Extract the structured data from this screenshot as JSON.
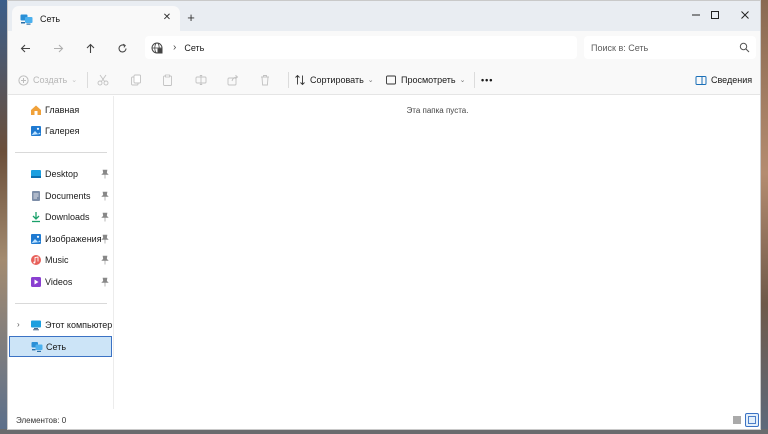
{
  "tab": {
    "title": "Сеть",
    "close": "✕",
    "new_tab": "+"
  },
  "window_controls": {
    "minimize": "—",
    "maximize": "☐",
    "close": "✕"
  },
  "address": {
    "path": "Сеть",
    "separator": "›"
  },
  "search": {
    "placeholder": "Поиск в: Сеть"
  },
  "commands": {
    "create": "Создать",
    "sort": "Сортировать",
    "view": "Просмотреть",
    "more": "•••",
    "details": "Сведения"
  },
  "sidebar": {
    "items": [
      {
        "label": "Главная",
        "icon": "home-icon"
      },
      {
        "label": "Галерея",
        "icon": "gallery-icon"
      },
      {
        "label": "Desktop",
        "icon": "desktop-icon",
        "pinned": true
      },
      {
        "label": "Documents",
        "icon": "documents-icon",
        "pinned": true
      },
      {
        "label": "Downloads",
        "icon": "downloads-icon",
        "pinned": true
      },
      {
        "label": "Изображения",
        "icon": "pictures-icon",
        "pinned": true
      },
      {
        "label": "Music",
        "icon": "music-icon",
        "pinned": true
      },
      {
        "label": "Videos",
        "icon": "videos-icon",
        "pinned": true
      },
      {
        "label": "Этот компьютер",
        "icon": "computer-icon"
      },
      {
        "label": "Сеть",
        "icon": "network-icon",
        "selected": true
      }
    ]
  },
  "content": {
    "empty_message": "Эта папка пуста."
  },
  "status": {
    "item_count": "Элементов: 0"
  },
  "colors": {
    "accent": "#3b72c4",
    "selected_bg": "#cce4f7",
    "chrome_bg": "#e9edf2"
  }
}
